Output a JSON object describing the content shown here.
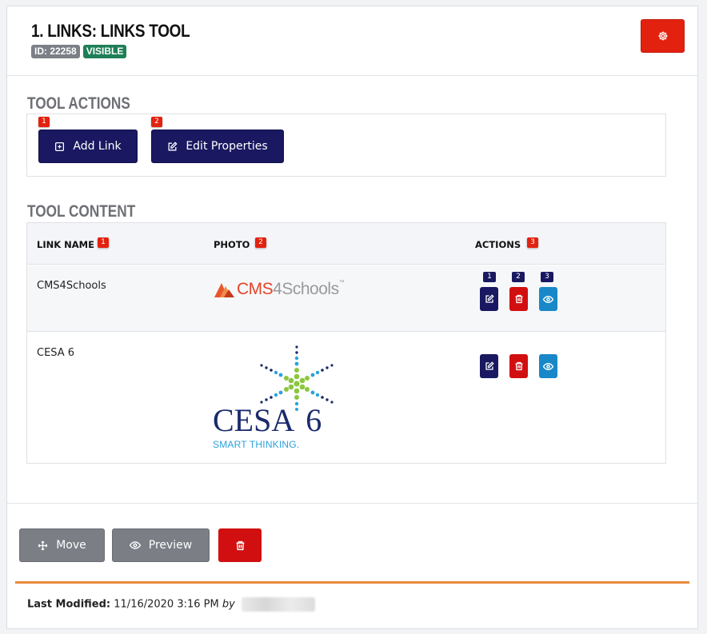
{
  "header": {
    "title": "1. LINKS: LINKS TOOL",
    "id_badge": "ID: 22258",
    "visible_badge": "VISIBLE"
  },
  "tool_actions": {
    "title": "TOOL ACTIONS",
    "buttons": [
      {
        "marker": "1",
        "label": "Add Link",
        "icon": "plus-square-icon"
      },
      {
        "marker": "2",
        "label": "Edit Properties",
        "icon": "edit-icon"
      }
    ]
  },
  "tool_content": {
    "title": "TOOL CONTENT",
    "columns": [
      {
        "label": "LINK NAME",
        "marker": "1"
      },
      {
        "label": "PHOTO",
        "marker": "2"
      },
      {
        "label": "ACTIONS",
        "marker": "3"
      }
    ],
    "action_markers": [
      "1",
      "2",
      "3"
    ],
    "rows": [
      {
        "name": "CMS4Schools",
        "photo": {
          "prefix": "CMS",
          "num": "4",
          "suffix": "Schools",
          "tm": "™"
        }
      },
      {
        "name": "CESA 6",
        "photo": {
          "word": "CESA",
          "num": "6",
          "tagline": "SMART THINKING."
        }
      }
    ]
  },
  "footer": {
    "move_label": "Move",
    "preview_label": "Preview",
    "modified_label": "Last Modified:",
    "modified_value": "11/16/2020 3:16 PM",
    "by_label": "by"
  },
  "colors": {
    "navy": "#191860",
    "red": "#e3210f",
    "delete_red": "#d20f10",
    "view_blue": "#1888c8",
    "visible_green": "#1e7f57",
    "orange": "#e88a3c"
  }
}
